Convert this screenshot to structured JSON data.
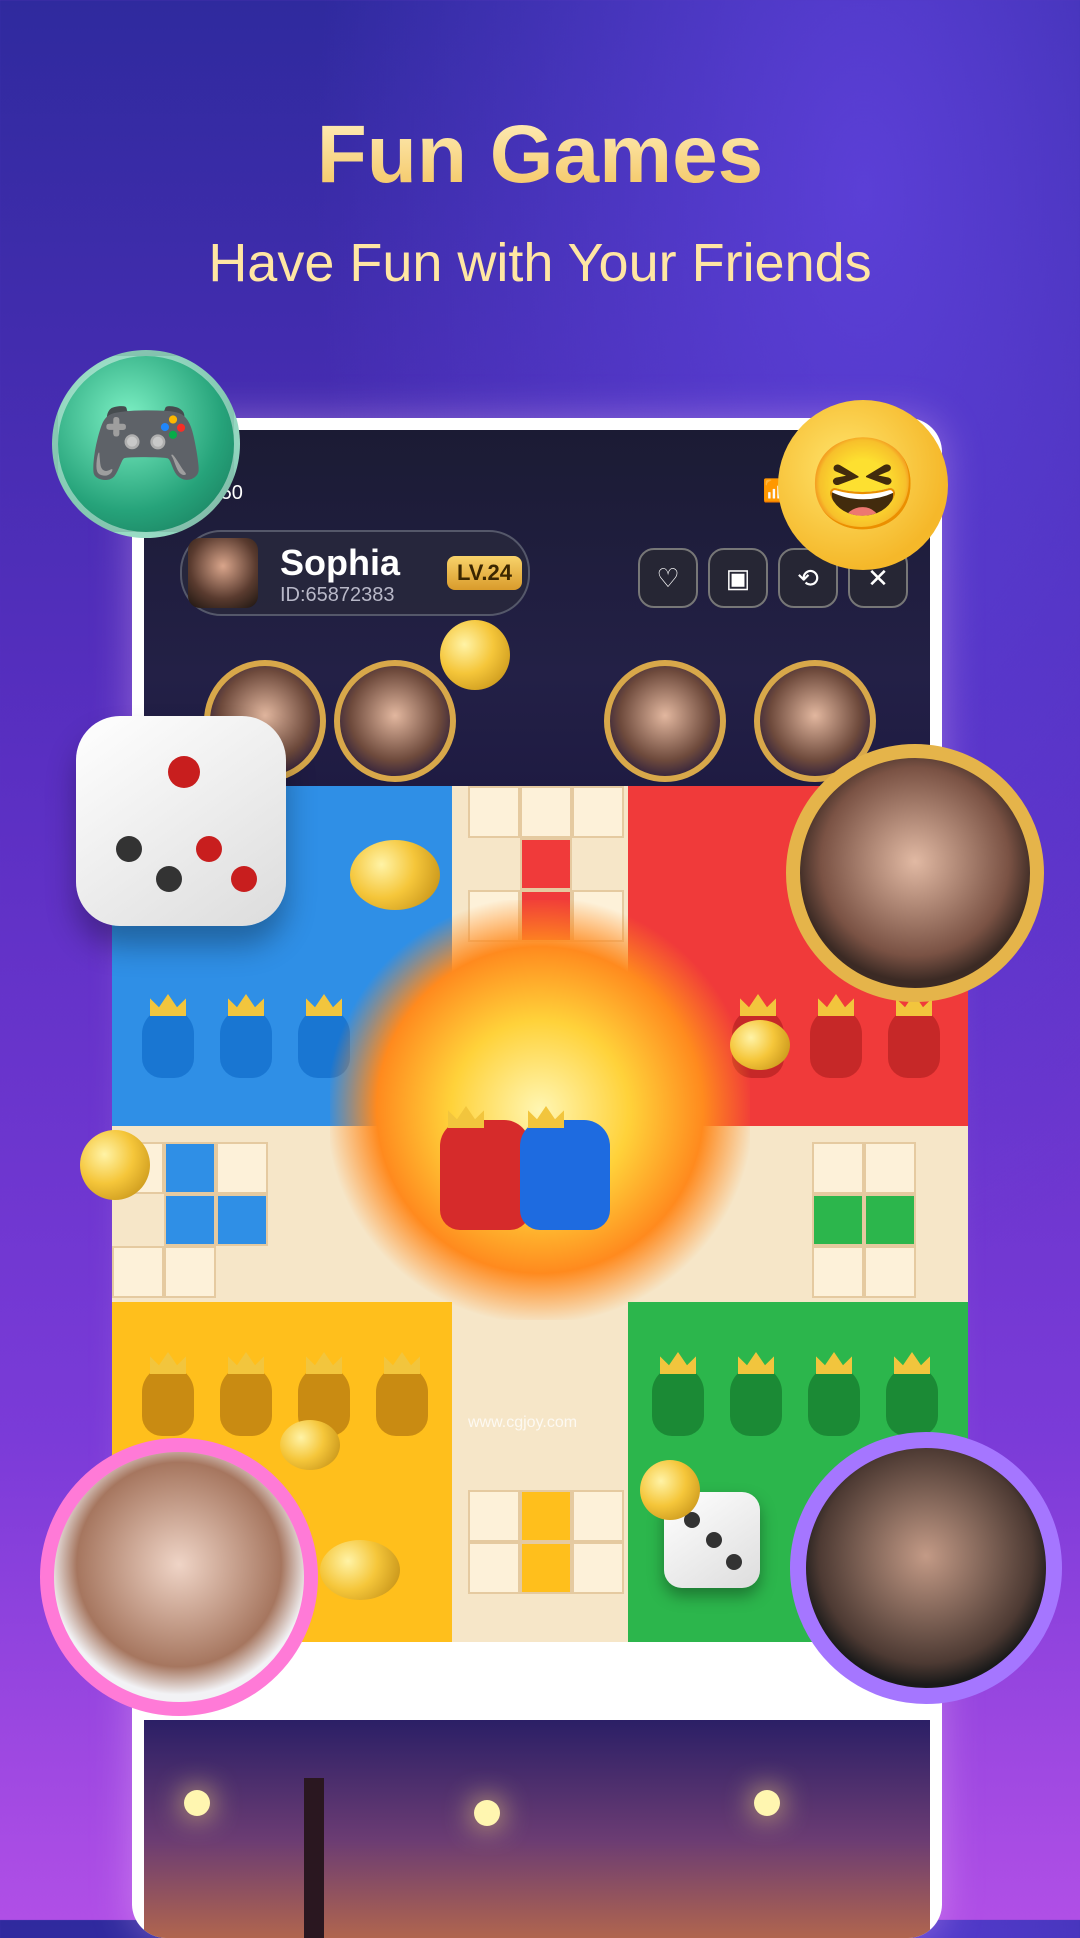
{
  "header": {
    "title": "Fun Games",
    "subtitle": "Have Fun with Your Friends"
  },
  "status_bar": {
    "time": "5:50",
    "icons": [
      "wifi-icon",
      "battery-icon"
    ]
  },
  "profile": {
    "name": "Sophia",
    "id": "ID:65872383",
    "level": "LV.24"
  },
  "top_actions": [
    {
      "icon": "heart-icon"
    },
    {
      "icon": "bag-icon"
    },
    {
      "icon": "share-icon"
    },
    {
      "icon": "close-icon"
    }
  ],
  "board": {
    "watermark": "www.cgjoy.com"
  },
  "colors": {
    "blue": "#2f8fe6",
    "red": "#f03a3a",
    "yellow": "#ffbf1c",
    "green": "#2cb64c",
    "title_gold": "#ffd97a"
  }
}
